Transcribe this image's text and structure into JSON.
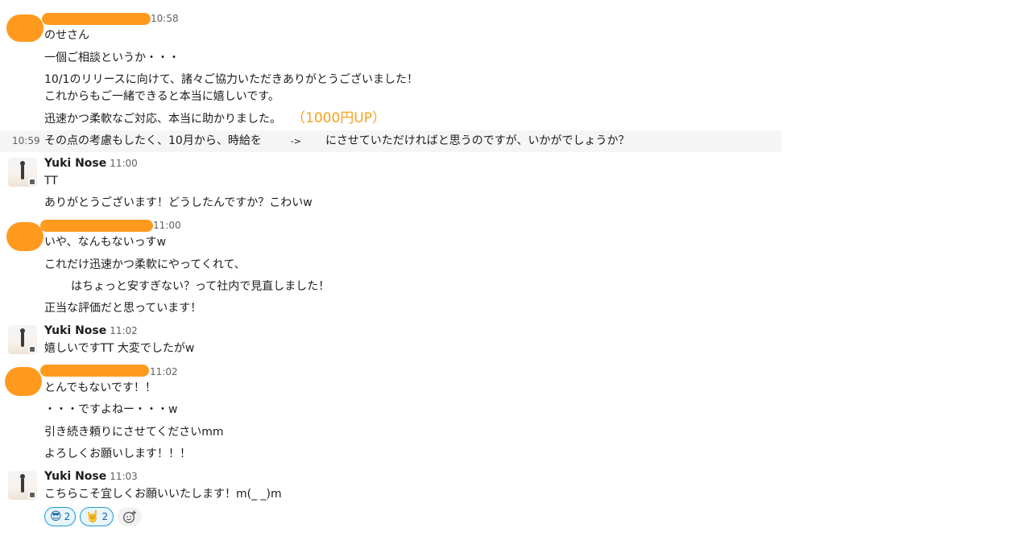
{
  "messages": {
    "m1": {
      "time": "10:58",
      "lines": [
        "のせさん",
        "一個ご相談というか・・・",
        "10/1のリリースに向けて、諸々ご協力いただきありがとうございました！",
        "これからもご一緒できると本当に嬉しいです。",
        "迅速かつ柔軟なご対応、本当に助かりました。"
      ],
      "annotation": "（1000円UP）"
    },
    "m2": {
      "time": "10:59",
      "part1": "その点の考慮もしたく、10月から、時給を",
      "part2": "->",
      "part3": "にさせていただければと思うのですが、いかがでしょうか？"
    },
    "m3": {
      "name": "Yuki Nose",
      "time": "11:00",
      "lines": [
        "TT",
        "ありがとうございます！どうしたんですか？こわいw"
      ]
    },
    "m4": {
      "time": "11:00",
      "lines": [
        "いや、なんもないっすw",
        "これだけ迅速かつ柔軟にやってくれて、",
        "はちょっと安すぎない？って社内で見直しました！",
        "正当な評価だと思っています！"
      ]
    },
    "m5": {
      "name": "Yuki Nose",
      "time": "11:02",
      "lines": [
        "嬉しいですTT 大変でしたがw"
      ]
    },
    "m6": {
      "time": "11:02",
      "lines": [
        "とんでもないです！！",
        "・・・ですよねー・・・w",
        "引き続き頼りにさせてくださいmm",
        "よろしくお願いします！！！"
      ]
    },
    "m7": {
      "name": "Yuki Nose",
      "time": "11:03",
      "lines": [
        "こちらこそ宜しくお願いいたします！m(_ _)m"
      ]
    }
  },
  "reactions": [
    {
      "emoji": "😎",
      "icon": "sunglasses-face-icon",
      "count": "2"
    },
    {
      "emoji": "🤘",
      "icon": "rock-hand-icon",
      "count": "2"
    }
  ],
  "add_reaction_icon": "add-emoji-icon",
  "colors": {
    "redaction": "#ff9a1f",
    "annotation": "#f7a11a",
    "reaction_border": "#1d9bd1"
  }
}
